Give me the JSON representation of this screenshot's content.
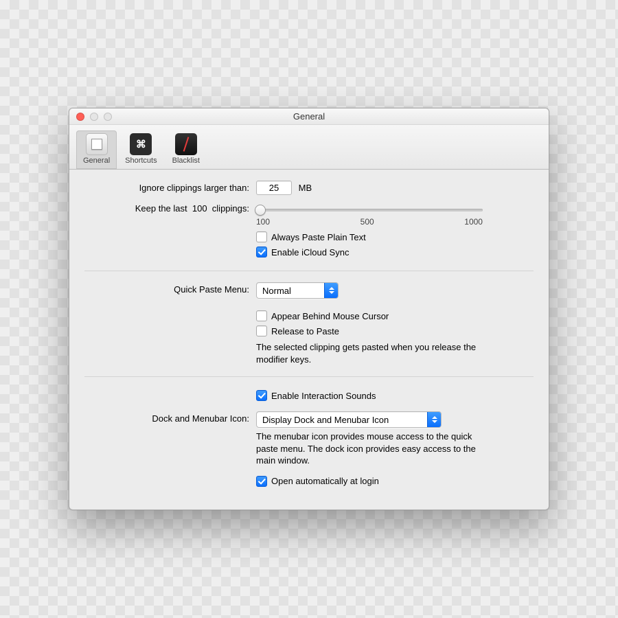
{
  "window": {
    "title": "General"
  },
  "toolbar": {
    "tabs": [
      {
        "label": "General",
        "selected": true
      },
      {
        "label": "Shortcuts",
        "selected": false
      },
      {
        "label": "Blacklist",
        "selected": false
      }
    ],
    "shortcuts_glyph": "⌘"
  },
  "section1": {
    "ignore_label": "Ignore clippings larger than:",
    "ignore_value": "25",
    "ignore_unit": "MB",
    "keep_label_prefix": "Keep the last",
    "keep_value": "100",
    "keep_label_suffix": "clippings:",
    "slider": {
      "min": "100",
      "mid": "500",
      "max": "1000"
    },
    "always_plain": {
      "label": "Always Paste Plain Text",
      "checked": false
    },
    "icloud": {
      "label": "Enable iCloud Sync",
      "checked": true
    }
  },
  "section2": {
    "quick_paste_label": "Quick Paste Menu:",
    "quick_paste_value": "Normal",
    "behind_cursor": {
      "label": "Appear Behind Mouse Cursor",
      "checked": false
    },
    "release_to_paste": {
      "label": "Release to Paste",
      "checked": false
    },
    "release_help": "The selected clipping gets pasted when you release the modifier keys."
  },
  "section3": {
    "sounds": {
      "label": "Enable Interaction Sounds",
      "checked": true
    },
    "dock_label": "Dock and Menubar Icon:",
    "dock_value": "Display Dock and Menubar Icon",
    "dock_help": "The menubar icon provides mouse access to the quick paste menu. The dock icon provides easy access to the main window.",
    "open_login": {
      "label": "Open automatically at login",
      "checked": true
    }
  }
}
